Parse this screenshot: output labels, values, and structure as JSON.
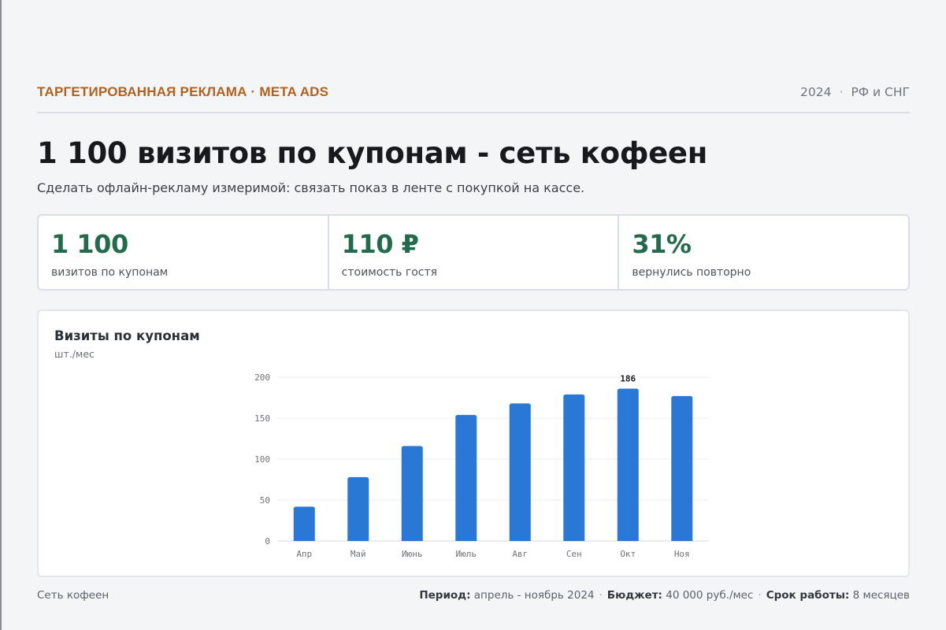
{
  "header": {
    "kicker": "ТАРГЕТИРОВАННАЯ РЕКЛАМА · META ADS",
    "year": "2024",
    "separator": "·",
    "region": "РФ и СНГ"
  },
  "title": "1 100 визитов по купонам - сеть кофеен",
  "subtitle": "Сделать офлайн-рекламу измеримой: связать показ в ленте с покупкой на кассе.",
  "kpis": [
    {
      "value": "1 100",
      "label": "визитов по купонам"
    },
    {
      "value": "110 ₽",
      "label": "стоимость гостя"
    },
    {
      "value": "31%",
      "label": "вернулись повторно"
    }
  ],
  "chart": {
    "title": "Визиты по купонам",
    "unit": "шт./мес"
  },
  "chart_data": {
    "type": "bar",
    "categories": [
      "Апр",
      "Май",
      "Июнь",
      "Июль",
      "Авг",
      "Сен",
      "Окт",
      "Ноя"
    ],
    "values": [
      42,
      78,
      116,
      154,
      168,
      179,
      186,
      177
    ],
    "ylim": [
      0,
      200
    ],
    "yticks": [
      0,
      50,
      100,
      150,
      200
    ],
    "grid": true,
    "annotations": [
      {
        "category": "Окт",
        "label": "186"
      }
    ],
    "bar_color": "#2a78d6"
  },
  "footer": {
    "client": "Сеть кофеен",
    "period_label": "Период:",
    "period_value": "апрель - ноябрь 2024",
    "budget_label": "Бюджет:",
    "budget_value": "40 000 руб./мес",
    "duration_label": "Срок работы:",
    "duration_value": "8 месяцев",
    "separator": "·"
  }
}
